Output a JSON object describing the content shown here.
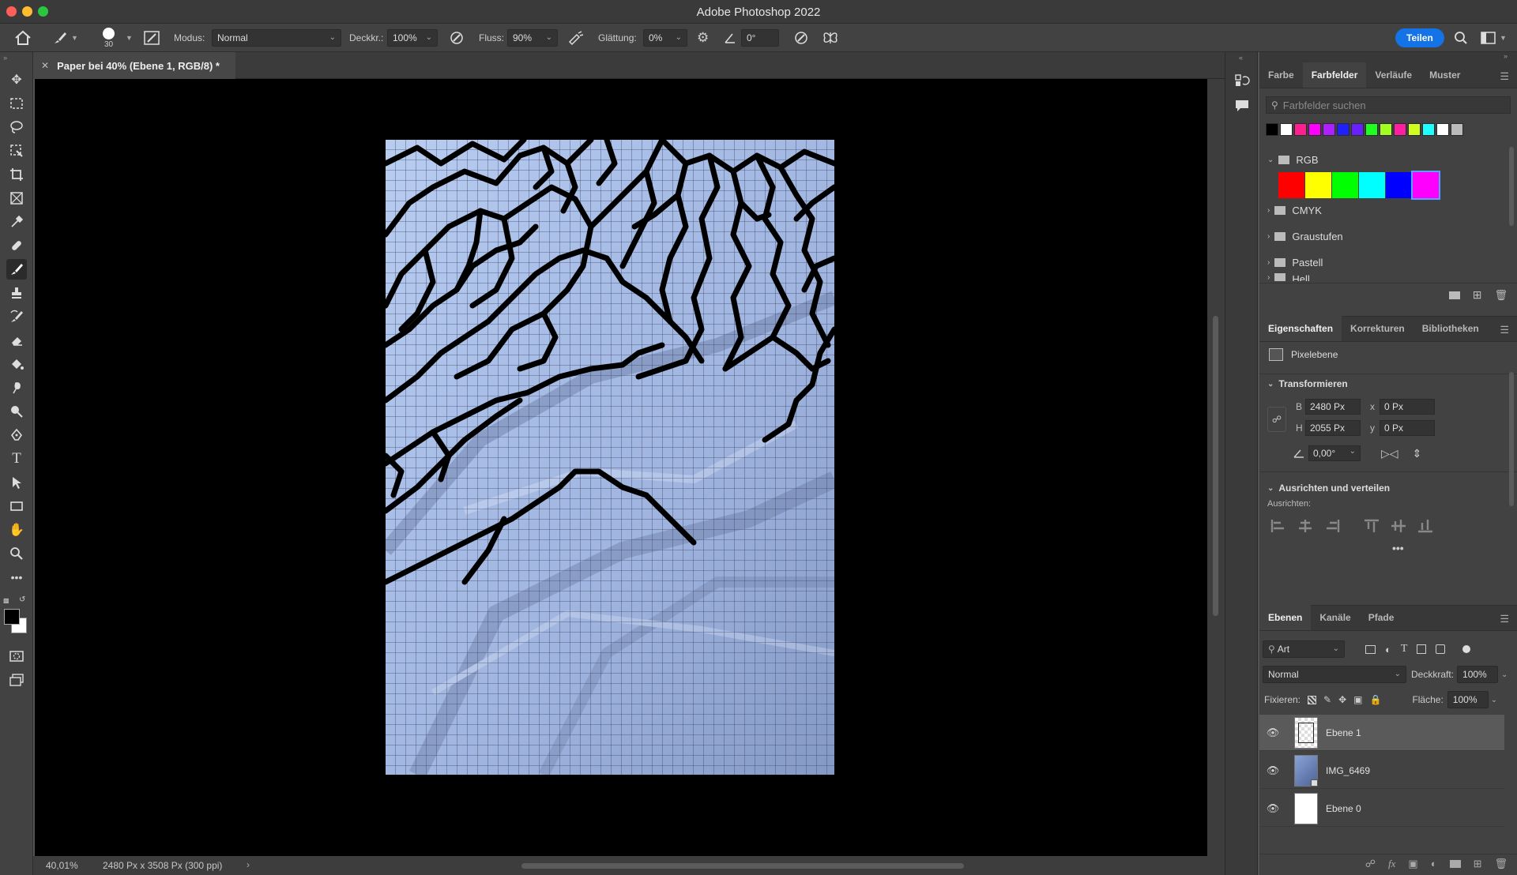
{
  "window": {
    "title": "Adobe Photoshop 2022"
  },
  "options": {
    "brush_size": "30",
    "mode_label": "Modus:",
    "mode_value": "Normal",
    "opacity_label": "Deckkr.:",
    "opacity_value": "100%",
    "flow_label": "Fluss:",
    "flow_value": "90%",
    "smoothing_label": "Glättung:",
    "smoothing_value": "0%",
    "angle_value": "0°",
    "share_label": "Teilen"
  },
  "document": {
    "tab_title": "Paper bei 40% (Ebene 1, RGB/8) *"
  },
  "status": {
    "zoom": "40,01%",
    "doc_info": "2480 Px x 3508 Px (300 ppi)"
  },
  "swatches_panel": {
    "tabs": [
      "Farbe",
      "Farbfelder",
      "Verläufe",
      "Muster"
    ],
    "search_placeholder": "Farbfelder suchen",
    "recent_colors": [
      "#000000",
      "#ffffff",
      "#ff1f8f",
      "#ff00ff",
      "#b01fff",
      "#1f1fff",
      "#6a1fff",
      "#1fff1f",
      "#a0ff1f",
      "#ff1fa0",
      "#d0ff1f",
      "#1fffff",
      "#ffffff",
      "#bbbbbb"
    ],
    "groups": [
      {
        "name": "RGB",
        "colors": [
          "#ff0000",
          "#ffff00",
          "#00ff00",
          "#00ffff",
          "#0000ff",
          "#ff00ff"
        ]
      },
      {
        "name": "CMYK"
      },
      {
        "name": "Graustufen"
      },
      {
        "name": "Pastell"
      },
      {
        "name": "Hell"
      }
    ]
  },
  "properties_panel": {
    "tabs": [
      "Eigenschaften",
      "Korrekturen",
      "Bibliotheken"
    ],
    "layer_type": "Pixelebene",
    "transform_title": "Transformieren",
    "w_label": "B",
    "w_value": "2480 Px",
    "x_label": "x",
    "x_value": "0 Px",
    "h_label": "H",
    "h_value": "2055 Px",
    "y_label": "y",
    "y_value": "0 Px",
    "angle_value": "0,00°",
    "align_title": "Ausrichten und verteilen",
    "align_label": "Ausrichten:"
  },
  "layers_panel": {
    "tabs": [
      "Ebenen",
      "Kanäle",
      "Pfade"
    ],
    "filter_value": "Art",
    "blend_mode": "Normal",
    "opacity_label": "Deckkraft:",
    "opacity_value": "100%",
    "lock_label": "Fixieren:",
    "fill_label": "Fläche:",
    "fill_value": "100%",
    "layers": [
      {
        "name": "Ebene 1"
      },
      {
        "name": "IMG_6469"
      },
      {
        "name": "Ebene 0"
      }
    ]
  }
}
